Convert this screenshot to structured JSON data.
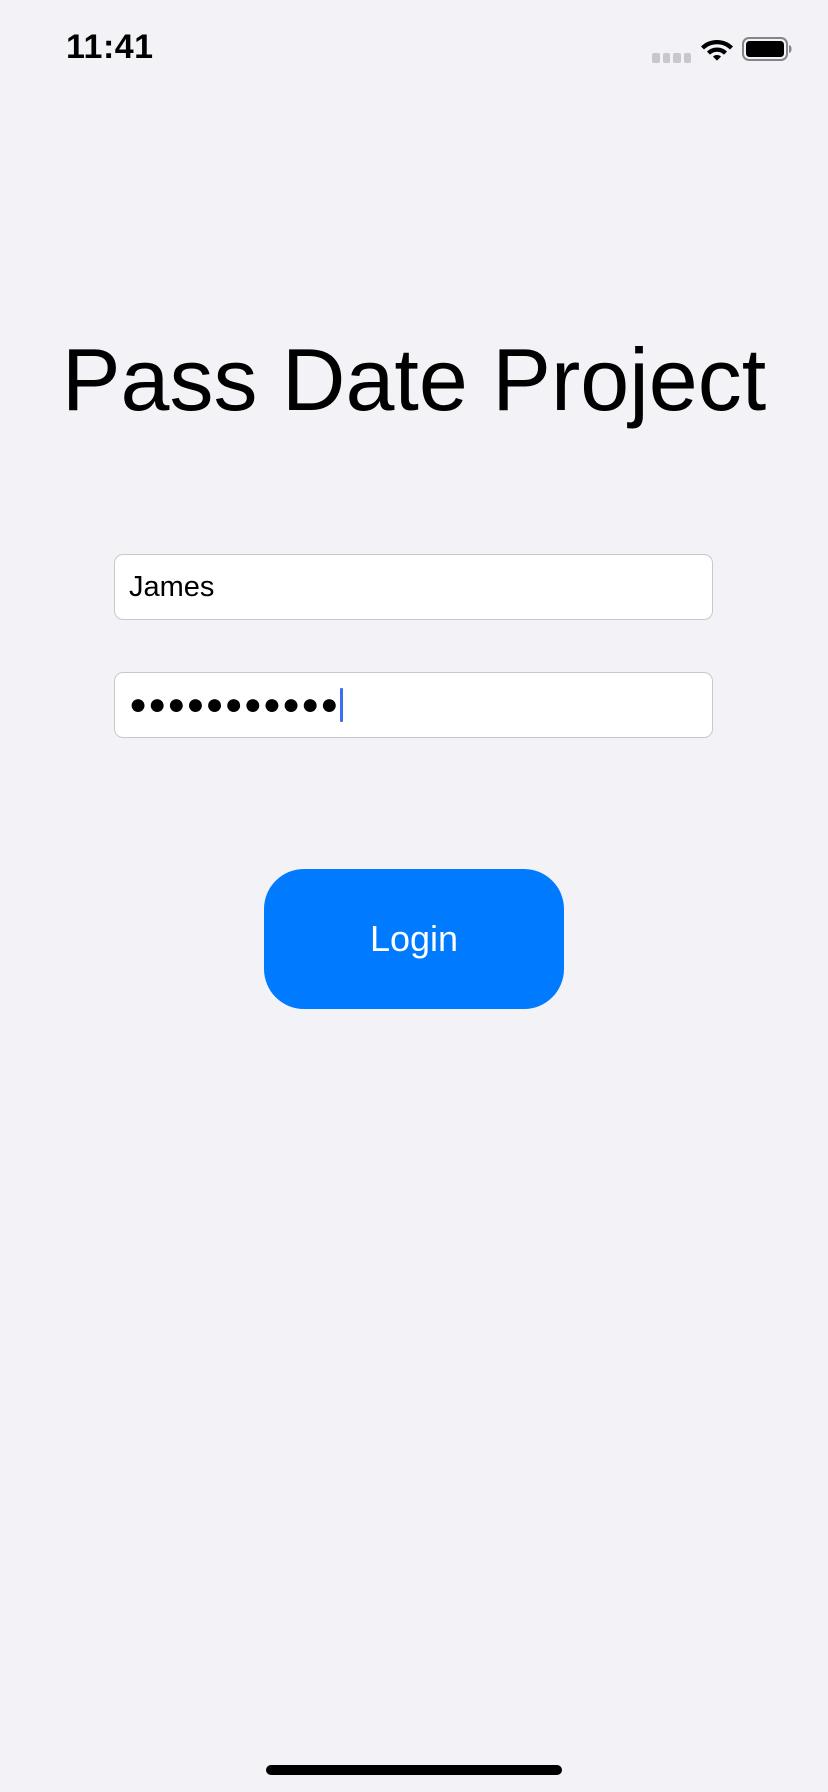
{
  "status_bar": {
    "time": "11:41",
    "icons": [
      "cellular-signal-icon",
      "wifi-icon",
      "battery-icon"
    ]
  },
  "title": "Pass Date Project",
  "form": {
    "username_value": "James",
    "password_value": "●●●●●●●●●●●"
  },
  "login_button": {
    "label": "Login"
  },
  "colors": {
    "background": "#f2f2f7",
    "accent": "#007aff",
    "cursor": "#3f6df2"
  }
}
